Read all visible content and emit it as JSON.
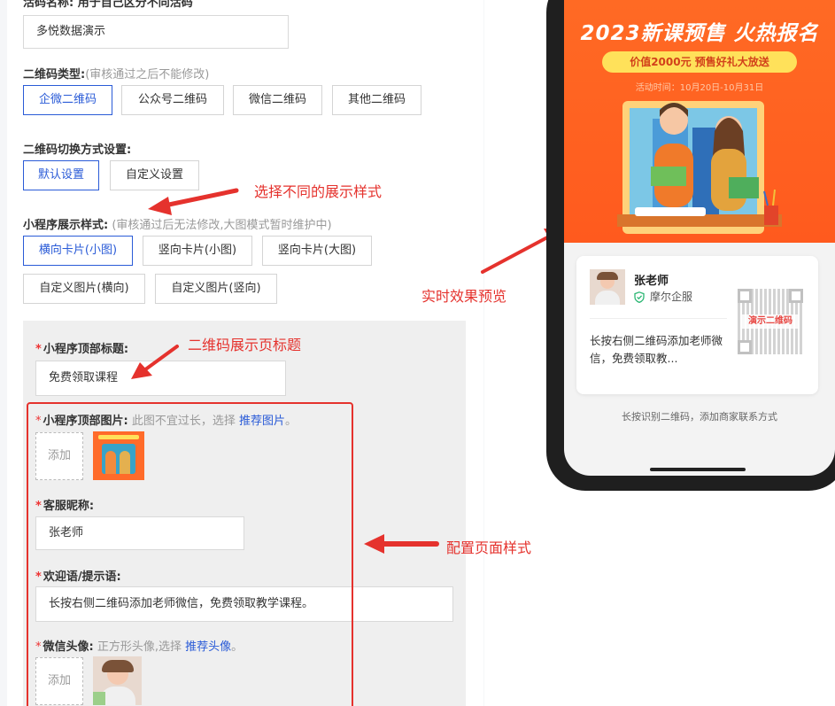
{
  "form": {
    "top_label_fragment": "活码名称: 用于自己区分不同活码",
    "name_value": "多悦数据演示",
    "qr_type": {
      "label": "二维码类型:",
      "hint": "(审核通过之后不能修改)",
      "options": [
        "企微二维码",
        "公众号二维码",
        "微信二维码",
        "其他二维码"
      ]
    },
    "switch_mode": {
      "label": "二维码切换方式设置:",
      "options": [
        "默认设置",
        "自定义设置"
      ]
    },
    "display_style": {
      "label": "小程序展示样式:",
      "hint": "(审核通过后无法修改,大图模式暂时维护中)",
      "options": [
        "横向卡片(小图)",
        "竖向卡片(小图)",
        "竖向卡片(大图)",
        "自定义图片(横向)",
        "自定义图片(竖向)"
      ]
    },
    "top_title": {
      "label": "小程序顶部标题:",
      "value": "免费领取课程"
    },
    "top_image": {
      "label": "小程序顶部图片:",
      "hint": "此图不宜过长，选择",
      "link": "推荐图片",
      "suffix": "。",
      "upload": "添加"
    },
    "nickname": {
      "label": "客服昵称:",
      "value": "张老师"
    },
    "welcome": {
      "label": "欢迎语/提示语:",
      "value": "长按右侧二维码添加老师微信，免费领取教学课程。"
    },
    "avatar": {
      "label": "微信头像:",
      "hint": "正方形头像,选择",
      "link": "推荐头像",
      "suffix": "。",
      "upload": "添加"
    },
    "required_mark": "*"
  },
  "annotations": {
    "style": "选择不同的展示样式",
    "title": "二维码展示页标题",
    "preview": "实时效果预览",
    "config": "配置页面样式"
  },
  "preview": {
    "poster_title": "2023新课预售 火热报名",
    "poster_pill": "价值2000元  预售好礼大放送",
    "poster_date": "活动时间：10月20日-10月31日",
    "teacher_name": "张老师",
    "company": "摩尔企服",
    "message": "长按右侧二维码添加老师微信，免费领取教...",
    "qr_label": "演示二维码",
    "caption": "长按识别二维码，添加商家联系方式"
  },
  "colors": {
    "accent": "#2a5bd7",
    "annotation": "#e5322d",
    "poster": "#ff5a1e"
  }
}
